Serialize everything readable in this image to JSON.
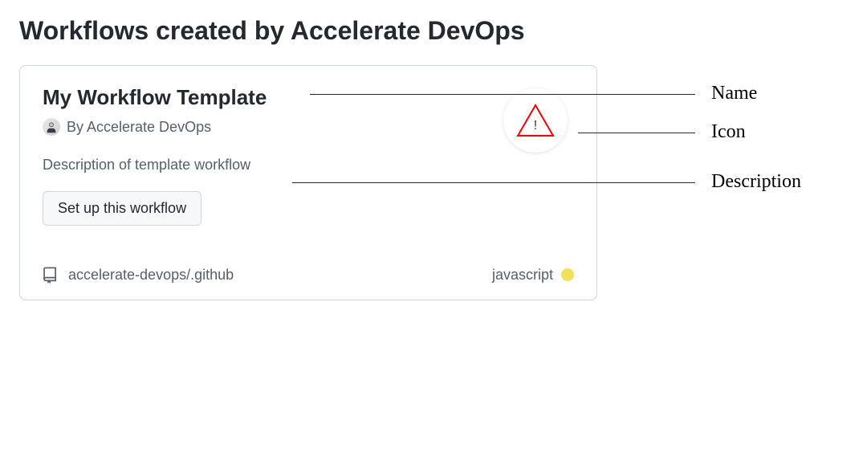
{
  "page": {
    "title": "Workflows created by Accelerate DevOps"
  },
  "card": {
    "name": "My Workflow Template",
    "by_prefix": "By ",
    "author": "Accelerate DevOps",
    "description": "Description of template workflow",
    "setup_button": "Set up this workflow",
    "repo": "accelerate-devops/.github",
    "language": "javascript",
    "language_color": "#f1e05a"
  },
  "annotations": {
    "name": "Name",
    "icon": "Icon",
    "description": "Description"
  }
}
